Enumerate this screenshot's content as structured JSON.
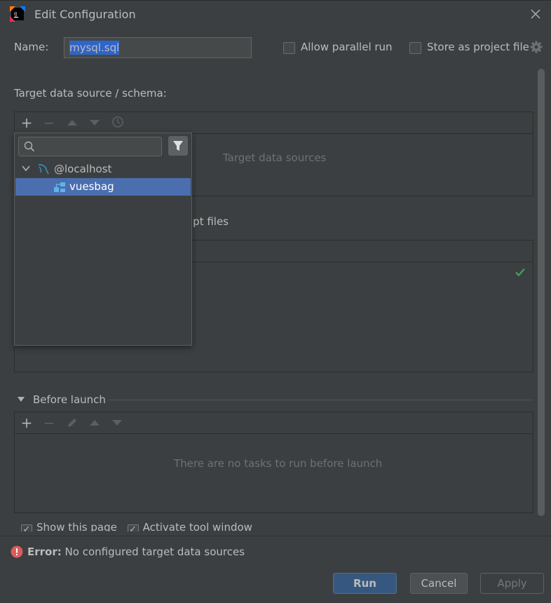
{
  "window": {
    "title": "Edit Configuration"
  },
  "config": {
    "name_label": "Name:",
    "name_value": "mysql.sql",
    "allow_parallel_label": "Allow parallel run",
    "store_project_label": "Store as project file"
  },
  "target": {
    "heading": "Target data source / schema:",
    "empty_text": "Target data sources"
  },
  "script": {
    "heading_visible_tail": "ipt files"
  },
  "popup": {
    "search_placeholder": "",
    "tree": [
      {
        "label": "@localhost",
        "expanded": true,
        "icon": "mysql-icon"
      },
      {
        "label": "vuesbag",
        "selected": true,
        "icon": "schema-icon"
      }
    ]
  },
  "before_launch": {
    "heading": "Before launch",
    "empty_text": "There are no tasks to run before launch"
  },
  "options": {
    "show_page_label": "Show this page",
    "activate_tool_label": "Activate tool window"
  },
  "error": {
    "prefix": "Error:",
    "message": "No configured target data sources"
  },
  "buttons": {
    "run": "Run",
    "cancel": "Cancel",
    "apply": "Apply"
  },
  "colors": {
    "background": "#3c3f41",
    "selection": "#4b6eaf",
    "primary_button": "#365880",
    "error": "#db5c5c",
    "success": "#499c54"
  }
}
